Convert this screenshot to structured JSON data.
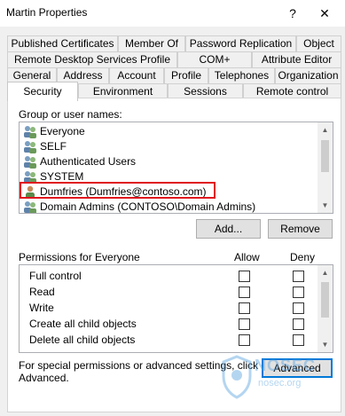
{
  "window": {
    "title": "Martin Properties",
    "help": "?",
    "close": "✕"
  },
  "tabs": {
    "row1": [
      "Published Certificates",
      "Member Of",
      "Password Replication",
      "Object"
    ],
    "row2": [
      "Remote Desktop Services Profile",
      "COM+",
      "Attribute Editor"
    ],
    "row3": [
      "General",
      "Address",
      "Account",
      "Profile",
      "Telephones",
      "Organization"
    ],
    "row4": [
      "Security",
      "Environment",
      "Sessions",
      "Remote control"
    ],
    "active": "Security"
  },
  "groups": {
    "label": "Group or user names:",
    "items": [
      {
        "name": "Everyone",
        "icon": "group-icon"
      },
      {
        "name": "SELF",
        "icon": "group-icon"
      },
      {
        "name": "Authenticated Users",
        "icon": "group-icon"
      },
      {
        "name": "SYSTEM",
        "icon": "group-icon"
      },
      {
        "name": "Dumfries (Dumfries@contoso.com)",
        "icon": "user-icon"
      },
      {
        "name": "Domain Admins (CONTOSO\\Domain Admins)",
        "icon": "group-icon"
      }
    ],
    "highlighted": "Dumfries (Dumfries@contoso.com)",
    "highlight_color": "#e0141e"
  },
  "buttons": {
    "add": "Add...",
    "remove": "Remove",
    "advanced": "Advanced"
  },
  "permissions": {
    "label": "Permissions for Everyone",
    "allow_header": "Allow",
    "deny_header": "Deny",
    "items": [
      {
        "name": "Full control",
        "allow": false,
        "deny": false
      },
      {
        "name": "Read",
        "allow": false,
        "deny": false
      },
      {
        "name": "Write",
        "allow": false,
        "deny": false
      },
      {
        "name": "Create all child objects",
        "allow": false,
        "deny": false
      },
      {
        "name": "Delete all child objects",
        "allow": false,
        "deny": false
      }
    ]
  },
  "footer": {
    "text_line1": "For special permissions or advanced settings, click",
    "text_line2": "Advanced."
  },
  "watermark": {
    "brand": "NOSEC",
    "domain": "nosec.org",
    "color": "#5aa3e0"
  }
}
